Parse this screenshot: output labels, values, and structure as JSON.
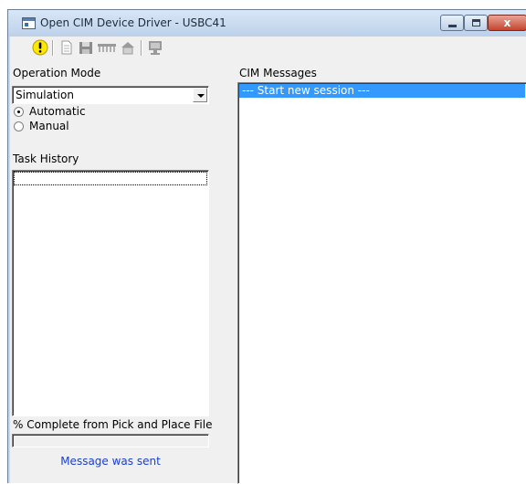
{
  "window": {
    "title": "Open CIM Device Driver - USBC41",
    "close_glyph": "x"
  },
  "toolbar": {
    "buttons": [
      {
        "name": "warning-icon",
        "enabled": true
      },
      {
        "name": "document-icon",
        "enabled": false
      },
      {
        "name": "save-icon",
        "enabled": false
      },
      {
        "name": "ruler-icon",
        "enabled": false
      },
      {
        "name": "home-icon",
        "enabled": false
      },
      {
        "name": "monitor-icon",
        "enabled": false
      }
    ]
  },
  "left_panel": {
    "operation_mode_label": "Operation Mode",
    "mode_select_value": "Simulation",
    "radio_options": [
      {
        "label": "Automatic",
        "checked": true
      },
      {
        "label": "Manual",
        "checked": false
      }
    ],
    "task_history_label": "Task History",
    "progress_label": "% Complete from Pick and Place File",
    "progress_value": 0,
    "status_message": "Message was sent"
  },
  "right_panel": {
    "cim_messages_label": "CIM Messages",
    "messages": [
      "--- Start new session ---"
    ]
  },
  "colors": {
    "selection": "#3399ff",
    "status_text": "#1a3fcf",
    "title_bar": "#c9d9ec"
  }
}
